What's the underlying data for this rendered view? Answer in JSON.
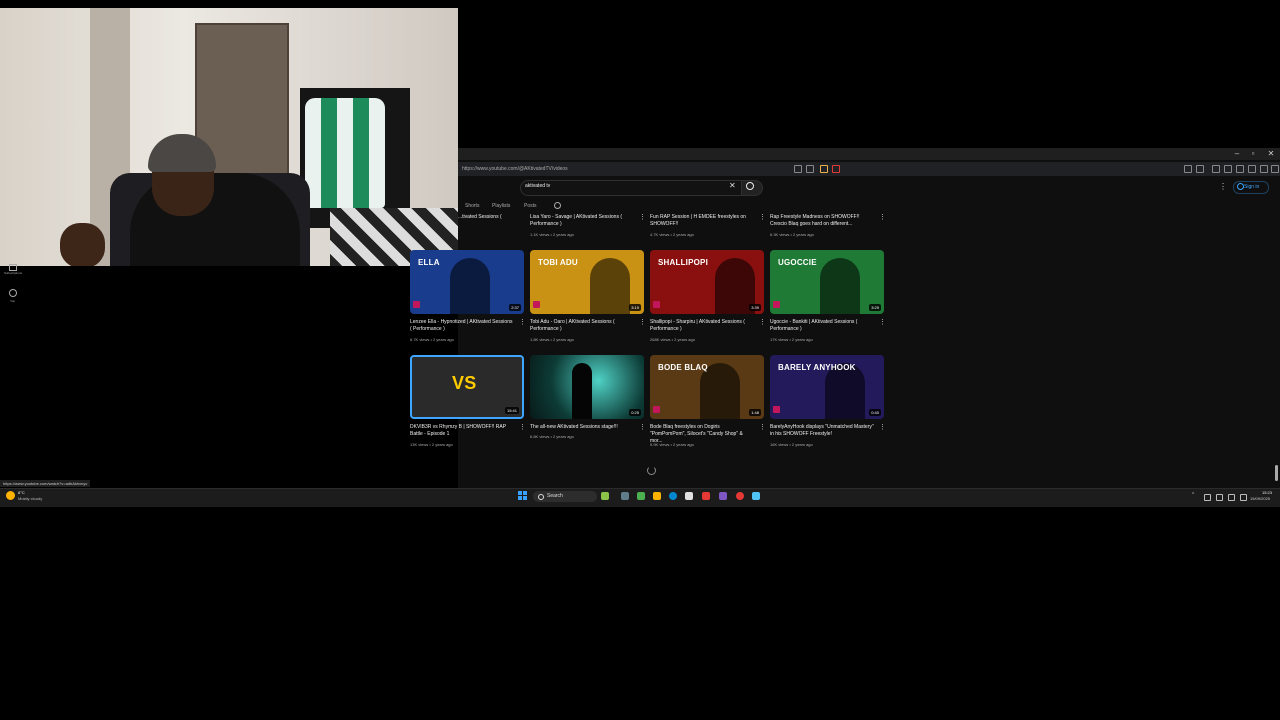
{
  "browser": {
    "url": "https://www.youtube.com/@AKtivatedTV/videos",
    "status_url": "https://www.youtube.com/watch?v=adbAkhxnyc"
  },
  "youtube": {
    "search_value": "aktivated tv",
    "sign_in": "Sign in",
    "tabs": [
      "Shorts",
      "Playlists",
      "Posts"
    ]
  },
  "sidebar": {
    "subscriptions": "Subscriptions",
    "you": "You"
  },
  "videos_row0": [
    {
      "title": "...tivated Sessions (",
      "meta": ""
    },
    {
      "title": "Lisa Yaro - Savage | AKtivated Sessions ( Performance )",
      "meta": "1.1K views • 2 years ago"
    },
    {
      "title": "Fun RAP Session | H EMDEE freestyles on SHOWOFF!!",
      "meta": "4.7K views • 2 years ago"
    },
    {
      "title": "Rap Freestyle Madness on SHOWOFF!! Crescio Blaq goes hard on different...",
      "meta": "6.3K views • 2 years ago"
    }
  ],
  "videos_row1": [
    {
      "thumb_title": "ELLA",
      "duration": "2:37",
      "title": "Lenzee Ella - Hypnotized | AKtivated Sessions ( Performance )",
      "meta": "6.7K views • 2 years ago",
      "color": "#1a3c8c"
    },
    {
      "thumb_title": "TOBI ADU",
      "duration": "3:19",
      "title": "Tobi Adu - Oaro | AKtivated Sessions ( Performance )",
      "meta": "1.8K views • 2 years ago",
      "color": "#c99214"
    },
    {
      "thumb_title": "SHALLIPOPI",
      "duration": "3:39",
      "title": "Shallipopi - Sharpiru | AKtivated Sessions ( Performance )",
      "meta": "268K views • 2 years ago",
      "color": "#8a1010"
    },
    {
      "thumb_title": "UGOCCIE",
      "duration": "3:29",
      "title": "Ugoccie - Bankiti | AKtivated Sessions ( Performance )",
      "meta": "17K views • 2 years ago",
      "color": "#1f7a35"
    }
  ],
  "videos_row2": [
    {
      "thumb_title": "VS",
      "duration": "15:41",
      "title": "DKVIB3R vs Rhymzy B | SHOWOFF!! RAP Battle - Episode 1",
      "meta": "13K views • 2 years ago",
      "color": "#2a2a2a"
    },
    {
      "thumb_title": "",
      "duration": "0:25",
      "title": "The all-new AKtivated Sessions stage!!!",
      "meta": "6.8K views • 2 years ago",
      "color": "#0d3b36"
    },
    {
      "thumb_title": "BODE BLAQ",
      "duration": "1:48",
      "title": "Bode Blaq freestyles on Dogiris \"PomPomPom\", Silocet's \"Candy Shop\" & mor...",
      "meta": "5.9K views • 2 years ago",
      "color": "#5a3a14"
    },
    {
      "thumb_title": "BARELY ANYHOOK",
      "duration": "0:40",
      "title": "BarelyAnyHook displays \"Unmatched Mastery\" in his SHOWOFF Freestyle!",
      "meta": "16K views • 2 years ago",
      "color": "#231a5c"
    }
  ],
  "taskbar": {
    "weather_temp": "8°C",
    "weather_desc": "Mostly cloudy",
    "search_label": "Search",
    "time": "15:23",
    "date": "15/09/2025"
  },
  "colors": {
    "accent": "#3ea6ff",
    "selected_border": "#3ea6ff"
  }
}
